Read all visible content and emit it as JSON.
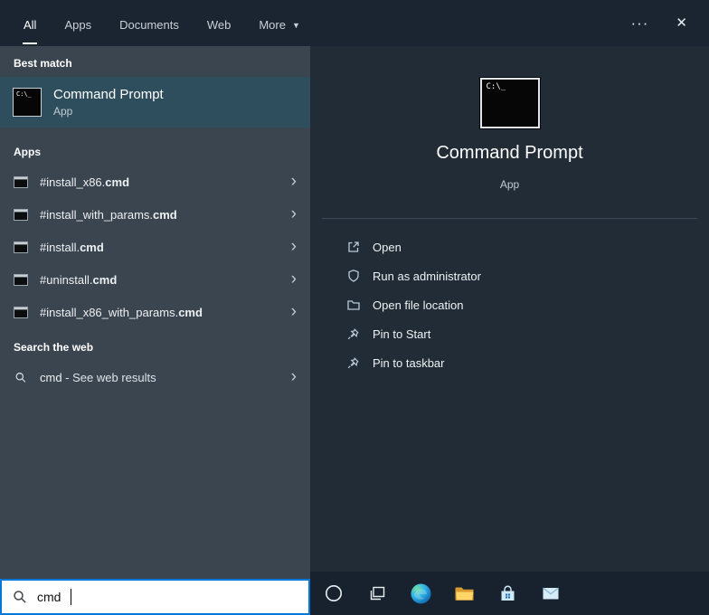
{
  "topbar": {
    "tabs": [
      {
        "label": "All"
      },
      {
        "label": "Apps"
      },
      {
        "label": "Documents"
      },
      {
        "label": "Web"
      },
      {
        "label": "More"
      }
    ],
    "more_caret": "▼",
    "ellipsis": "···",
    "close": "✕"
  },
  "left": {
    "best_match": {
      "header": "Best match",
      "item": {
        "title": "Command Prompt",
        "subtitle": "App"
      }
    },
    "apps": {
      "header": "Apps",
      "items": [
        {
          "prefix": "#install_x86.",
          "match": "cmd"
        },
        {
          "prefix": "#install_with_params.",
          "match": "cmd"
        },
        {
          "prefix": "#install.",
          "match": "cmd"
        },
        {
          "prefix": "#uninstall.",
          "match": "cmd"
        },
        {
          "prefix": "#install_x86_with_params.",
          "match": "cmd"
        }
      ]
    },
    "search_web": {
      "header": "Search the web",
      "item": {
        "query": "cmd",
        "rest": " - See web results"
      }
    },
    "chevron": "›"
  },
  "preview": {
    "title": "Command Prompt",
    "subtitle": "App",
    "actions": [
      {
        "label": "Open",
        "icon": "open-icon"
      },
      {
        "label": "Run as administrator",
        "icon": "shield-icon"
      },
      {
        "label": "Open file location",
        "icon": "folder-icon"
      },
      {
        "label": "Pin to Start",
        "icon": "pin-icon"
      },
      {
        "label": "Pin to taskbar",
        "icon": "pin-icon"
      }
    ]
  },
  "icons": {
    "cmd_glyph": "C:\\_"
  },
  "search_box": {
    "value": "cmd"
  },
  "taskbar": {
    "icons": [
      "cortana",
      "task-view",
      "edge",
      "file-explorer",
      "store",
      "mail"
    ]
  },
  "colors": {
    "accent": "#0078d7",
    "topbar_bg": "#1b2531",
    "left_bg": "#3a454f",
    "highlight_bg": "#2e4e5d",
    "right_bg": "#212c36",
    "taskbar_bg": "#18222e"
  }
}
